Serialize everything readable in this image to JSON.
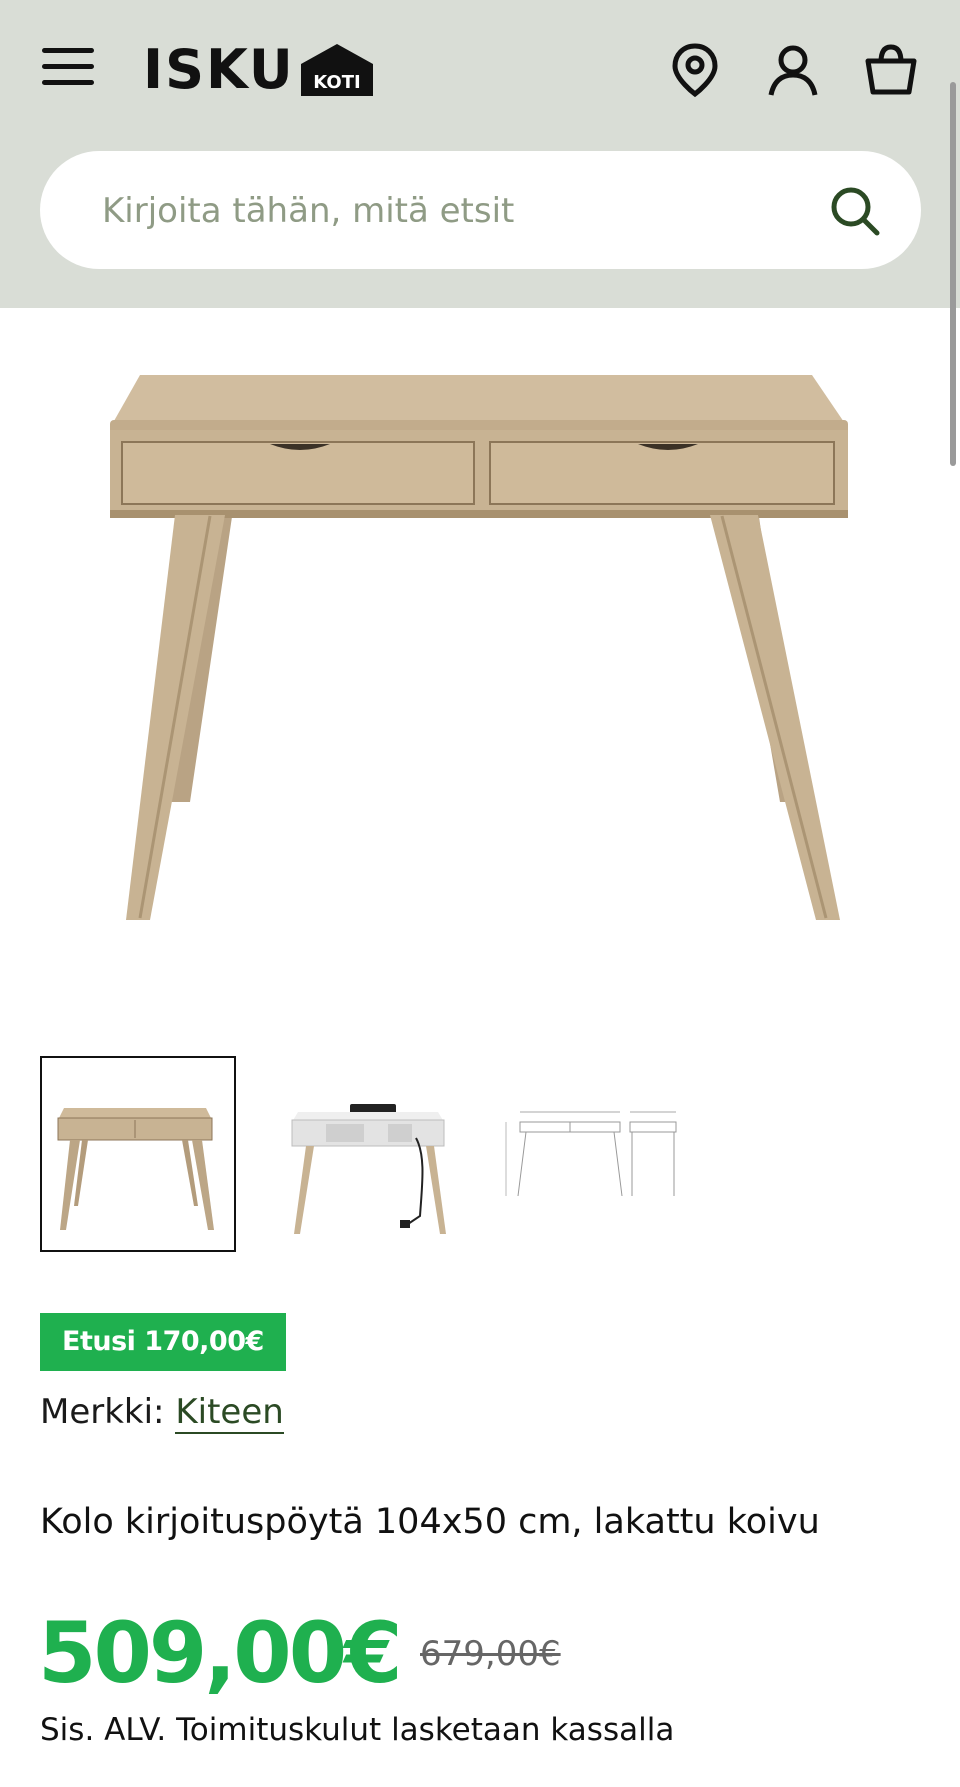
{
  "header": {
    "logo_text": "ISKU",
    "logo_sub": "KOTI",
    "icons": [
      "menu-icon",
      "location-pin-icon",
      "user-icon",
      "cart-icon"
    ]
  },
  "search": {
    "placeholder": "Kirjoita tähän, mitä etsit"
  },
  "product": {
    "badge": "Etusi 170,00€",
    "brand_label": "Merkki:",
    "brand_name": "Kiteen",
    "title": "Kolo kirjoituspöytä 104x50 cm, lakattu koivu",
    "price": "509,00€",
    "old_price": "679,00€",
    "vat_note": "Sis. ALV. Toimituskulut lasketaan kassalla"
  },
  "thumbnails": [
    "Desk front view",
    "Desk with white drawers and cable",
    "Dimension drawing"
  ],
  "colors": {
    "header_bg": "#d9ddd6",
    "accent_green": "#1fb04f",
    "brand_link": "#2b4a24",
    "wood": "#c9b394"
  }
}
